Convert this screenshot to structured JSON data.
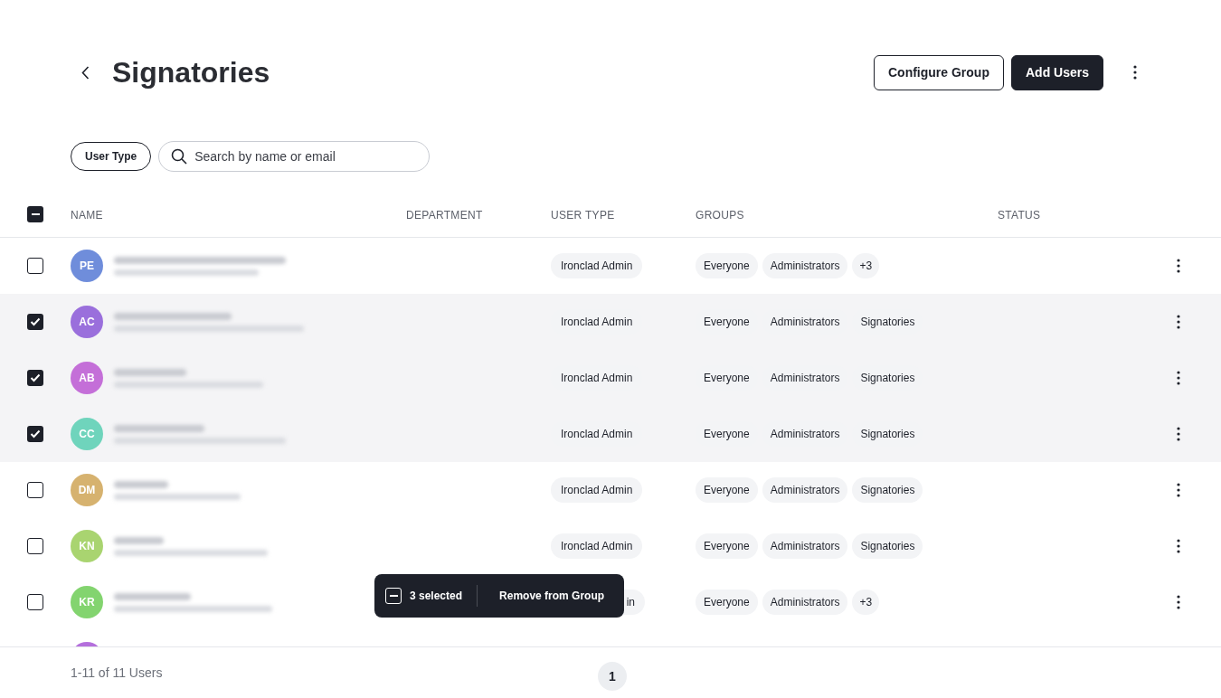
{
  "header": {
    "title": "Signatories",
    "buttons": [
      {
        "label": "Configure Group",
        "kind": "outline"
      },
      {
        "label": "Add Users",
        "kind": "solid"
      }
    ]
  },
  "filters": {
    "user_type_button": "User Type",
    "search": {
      "placeholder": "Search by name or email"
    }
  },
  "table": {
    "select_all": {
      "indeterminate": true
    },
    "columns": [
      "NAME",
      "DEPARTMENT",
      "USER TYPE",
      "GROUPS",
      "STATUS"
    ],
    "rows": [
      {
        "initials": "PE",
        "color": "#6f8ddb",
        "selected": false,
        "user_type": "Ironclad Admin",
        "groups": [
          "Everyone",
          "Administrators"
        ],
        "more_groups": "+3"
      },
      {
        "initials": "AC",
        "color": "#9a6fdc",
        "selected": true,
        "user_type": "Ironclad Admin",
        "groups": [
          "Everyone",
          "Administrators",
          "Signatories"
        ]
      },
      {
        "initials": "AB",
        "color": "#c46fd8",
        "selected": true,
        "user_type": "Ironclad Admin",
        "groups": [
          "Everyone",
          "Administrators",
          "Signatories"
        ]
      },
      {
        "initials": "CC",
        "color": "#6fd4bc",
        "selected": true,
        "user_type": "Ironclad Admin",
        "groups": [
          "Everyone",
          "Administrators",
          "Signatories"
        ]
      },
      {
        "initials": "DM",
        "color": "#d6b26f",
        "selected": false,
        "user_type": "Ironclad Admin",
        "groups": [
          "Everyone",
          "Administrators",
          "Signatories"
        ]
      },
      {
        "initials": "KN",
        "color": "#a9d470",
        "selected": false,
        "user_type": "Ironclad Admin",
        "groups": [
          "Everyone",
          "Administrators",
          "Signatories"
        ]
      },
      {
        "initials": "KR",
        "color": "#83d46f",
        "selected": false,
        "user_type": "in",
        "user_type_covered": true,
        "groups": [
          "Everyone",
          "Administrators"
        ],
        "more_groups": "+3"
      }
    ],
    "partial_row": {
      "color": "#b46fdc"
    }
  },
  "selection_bar": {
    "indeterminate": true,
    "count": "3 selected",
    "action": "Remove from Group"
  },
  "footer": {
    "summary": "1-11 of 11 Users",
    "pages": [
      {
        "label": "1",
        "selected": true
      }
    ]
  }
}
